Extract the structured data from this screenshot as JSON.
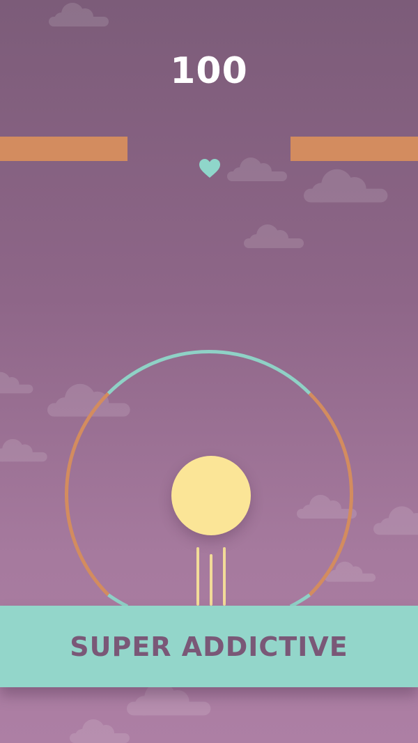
{
  "game": {
    "score": "100",
    "banner_text": "SUPER ADDICTIVE"
  },
  "colors": {
    "background_top": "#7c5c79",
    "background_bottom": "#ad7fa4",
    "wall": "#d38c5f",
    "ring_teal": "#8fd1c6",
    "ring_orange": "#d38c5f",
    "ball": "#fbe597",
    "banner": "#93d6ca",
    "banner_text": "#7a5877",
    "heart": "#8fd6ca"
  },
  "icons": {
    "heart": "heart-icon",
    "cloud": "cloud-icon"
  }
}
